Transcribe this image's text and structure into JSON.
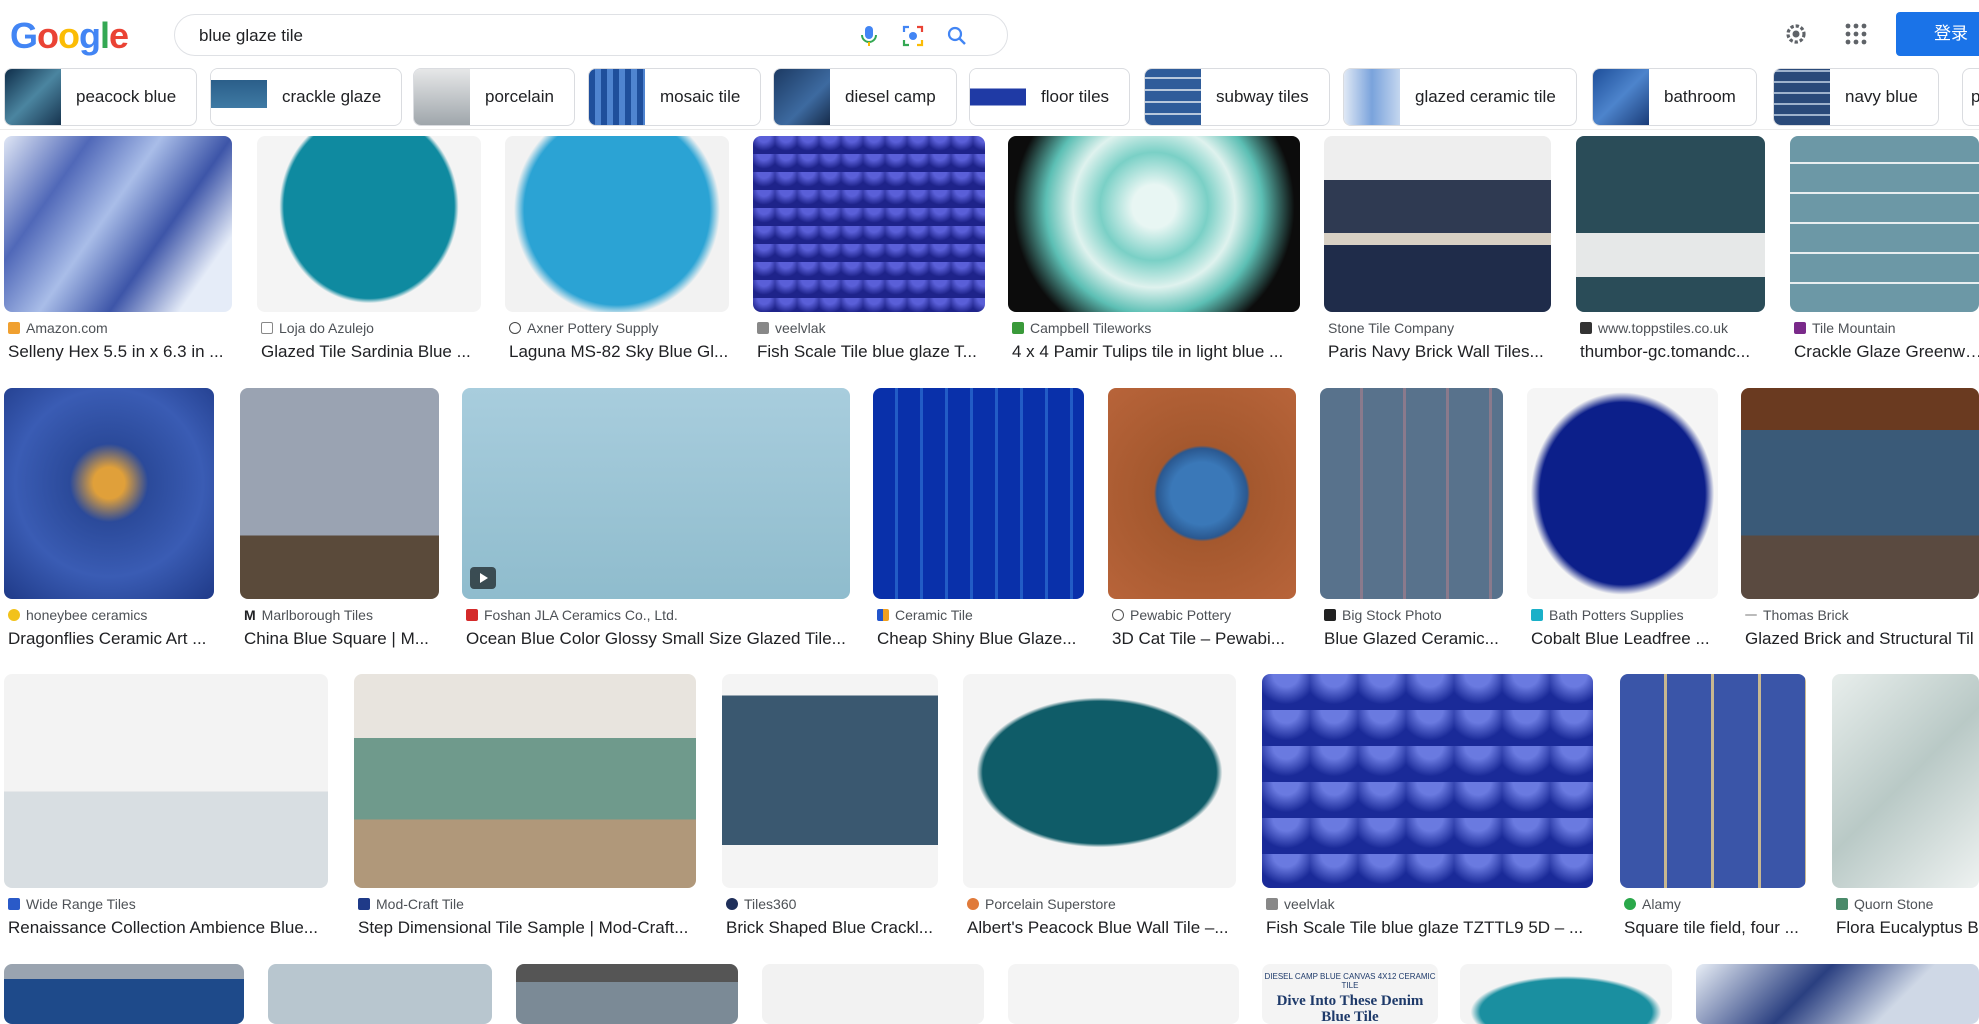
{
  "header": {
    "logo_letters": [
      "G",
      "o",
      "o",
      "g",
      "l",
      "e"
    ],
    "logo_colors": [
      "#4285f4",
      "#ea4335",
      "#fbbc05",
      "#4285f4",
      "#34a853",
      "#ea4335"
    ],
    "search_value": "blue glaze tile",
    "icons": [
      "mic-icon",
      "lens-icon",
      "search-icon",
      "settings-gear-icon",
      "apps-grid-icon"
    ],
    "login_label": "登录",
    "accent": "#1a73e8"
  },
  "chips": [
    {
      "label": "peacock blue",
      "color": "#2d5a7a"
    },
    {
      "label": "crackle glaze",
      "color": "#3b6f95"
    },
    {
      "label": "porcelain",
      "color": "#b9bfc3"
    },
    {
      "label": "mosaic tile",
      "color": "#2c5fa8"
    },
    {
      "label": "diesel camp",
      "color": "#2b4e7d"
    },
    {
      "label": "floor tiles",
      "color": "#1e3aa0"
    },
    {
      "label": "subway tiles",
      "color": "#3a67a8"
    },
    {
      "label": "glazed ceramic tile",
      "color": "#8fb4e3"
    },
    {
      "label": "bathroom",
      "color": "#2f5ea8"
    },
    {
      "label": "navy blue",
      "color": "#3c5f90"
    },
    {
      "label": "po",
      "color": "#6b8cbf"
    }
  ],
  "results": [
    {
      "source": "Amazon.com",
      "title": "Selleny Hex 5.5 in x 6.3 in ...",
      "color": "#5a78c2"
    },
    {
      "source": "Loja do Azulejo",
      "title": "Glazed Tile Sardinia Blue ...",
      "color": "#1a8aa0"
    },
    {
      "source": "Axner Pottery Supply",
      "title": "Laguna MS-82 Sky Blue Gl...",
      "color": "#2f9fc8"
    },
    {
      "source": "veelvlak",
      "title": "Fish Scale Tile blue glaze T...",
      "color": "#2a2f9a"
    },
    {
      "source": "Campbell Tileworks",
      "title": "4 x 4 Pamir Tulips tile in light blue ...",
      "color": "#6fc8c0"
    },
    {
      "source": "Stone Tile Company",
      "title": "Paris Navy Brick Wall Tiles...",
      "color": "#3b4a6b"
    },
    {
      "source": "www.toppstiles.co.uk",
      "title": "thumbor-gc.tomandc...",
      "color": "#2e4f5c"
    },
    {
      "source": "Tile Mountain",
      "title": "Crackle Glaze Greenwich",
      "color": "#6f9aa8"
    },
    {
      "source": "honeybee ceramics",
      "title": "Dragonflies Ceramic Art ...",
      "color": "#2f4e9a"
    },
    {
      "source": "Marlborough Tiles",
      "title": "China Blue Square | M...",
      "color": "#8a95a6"
    },
    {
      "source": "Foshan JLA Ceramics Co., Ltd.",
      "title": "Ocean Blue Color Glossy Small Size Glazed Tile...",
      "color": "#9ec4d6"
    },
    {
      "source": "Ceramic Tile",
      "title": "Cheap Shiny Blue Glaze...",
      "color": "#3a7ad0"
    },
    {
      "source": "Pewabic Pottery",
      "title": "3D Cat Tile – Pewabi...",
      "color": "#a0542c"
    },
    {
      "source": "Big Stock Photo",
      "title": "Blue Glazed Ceramic...",
      "color": "#56708a"
    },
    {
      "source": "Bath Potters Supplies",
      "title": "Cobalt Blue Leadfree ...",
      "color": "#0c1f8a"
    },
    {
      "source": "Thomas Brick",
      "title": "Glazed Brick and Structural Til",
      "color": "#4a5a70"
    },
    {
      "source": "Wide Range Tiles",
      "title": "Renaissance Collection Ambience Blue...",
      "color": "#cfd8dc"
    },
    {
      "source": "Mod-Craft Tile",
      "title": "Step Dimensional Tile Sample | Mod-Craft...",
      "color": "#7ca79a"
    },
    {
      "source": "Tiles360",
      "title": "Brick Shaped Blue Crackl...",
      "color": "#3d5a70"
    },
    {
      "source": "Porcelain Superstore",
      "title": "Albert's Peacock Blue Wall Tile –...",
      "color": "#0f5c68"
    },
    {
      "source": "veelvlak",
      "title": "Fish Scale Tile blue glaze TZTTL9 5D – ...",
      "color": "#2438a8"
    },
    {
      "source": "Alamy",
      "title": "Square tile field, four ...",
      "color": "#5a6ea8"
    },
    {
      "source": "Quorn Stone",
      "title": "Flora Eucalyptus B",
      "color": "#c8d6d4"
    }
  ],
  "row4_texts": [
    "DIESEL CAMP BLUE CANVAS 4X12 CERAMIC TILE",
    "Dive Into These Denim Blue Tile"
  ],
  "row4_colors": [
    "#1e4a8a",
    "#b8c6cf",
    "#7b8a96",
    "#e8ebee",
    "#eef0f2",
    "#f2f2f2",
    "#1a8fa0",
    "#2a3f80"
  ]
}
